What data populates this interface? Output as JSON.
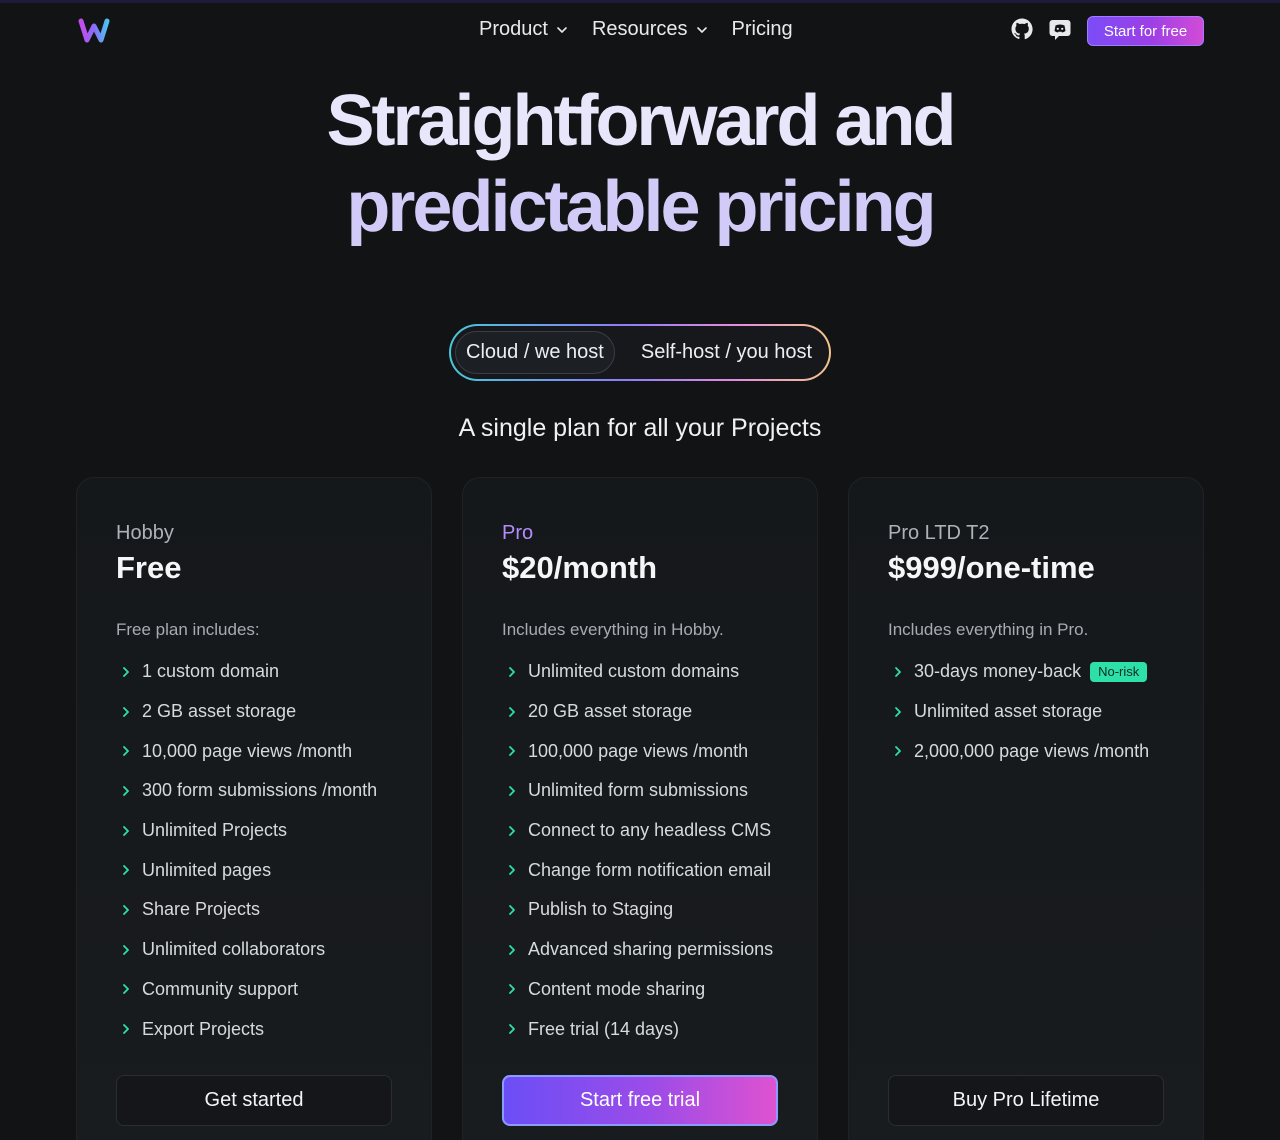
{
  "nav": {
    "links": [
      {
        "label": "Product",
        "dropdown": true
      },
      {
        "label": "Resources",
        "dropdown": true
      },
      {
        "label": "Pricing",
        "dropdown": false
      }
    ],
    "icons": [
      "github-icon",
      "discord-icon"
    ],
    "cta_label": "Start for free"
  },
  "hero": {
    "line1": "Straightforward and",
    "line2": "predictable pricing"
  },
  "toggle": {
    "options": [
      "Cloud / we host",
      "Self-host / you host"
    ],
    "selected": "Cloud / we host"
  },
  "subtitle": "A single plan for all your Projects",
  "plans": [
    {
      "name": "Hobby",
      "price": "Free",
      "description": "Free plan includes:",
      "features": [
        "1 custom domain",
        "2 GB asset storage",
        "10,000 page views /month",
        "300 form submissions  /month",
        "Unlimited Projects",
        "Unlimited pages",
        "Share Projects",
        "Unlimited collaborators",
        "Community support",
        "Export Projects"
      ],
      "button": "Get started"
    },
    {
      "name": "Pro",
      "price": "$20/month",
      "description": "Includes everything in Hobby.",
      "features": [
        "Unlimited custom domains",
        "20 GB asset storage",
        "100,000 page views /month",
        "Unlimited form submissions",
        "Connect to any headless CMS",
        "Change form notification email",
        "Publish to Staging",
        "Advanced sharing permissions",
        "Content mode sharing",
        "Free trial (14 days)"
      ],
      "button": "Start free trial"
    },
    {
      "name": "Pro LTD T2",
      "price": "$999/one-time",
      "description": "Includes everything in Pro.",
      "features": [
        "30-days money-back",
        "Unlimited asset storage",
        "2,000,000 page views /month"
      ],
      "badge": "No-risk",
      "button": "Buy Pro Lifetime"
    }
  ],
  "colors": {
    "background": "#111315",
    "accent_purple": "#7b4cf7",
    "accent_pink": "#de52d0",
    "check_green": "#2de0a7",
    "pro_label": "#b48cff"
  }
}
